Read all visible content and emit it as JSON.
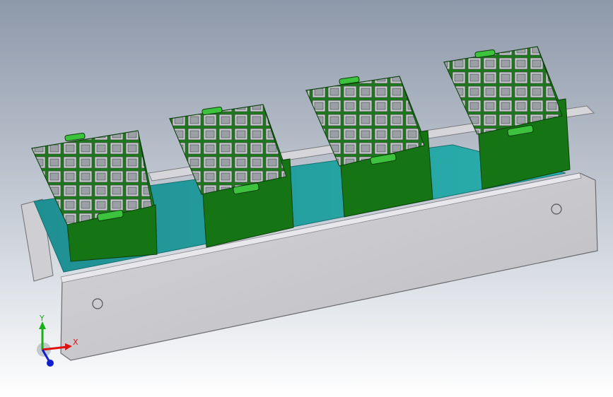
{
  "scene": {
    "description_visible_text": "",
    "colors": {
      "background_top": "#8b96a7",
      "background_bottom": "#ffffff",
      "frame": "#c8c8cc",
      "frame_edge": "#9a9aa0",
      "belt": "#2aa0a0",
      "tray_green": "#1f8a1f",
      "tray_dark": "#0e5a0e",
      "tray_light": "#34b034",
      "cell_gray": "#b8bcc0",
      "axis_x": "#e01010",
      "axis_y": "#10b010",
      "axis_z": "#1020d0"
    }
  },
  "axes": {
    "x_label": "X",
    "y_label": "Y"
  }
}
